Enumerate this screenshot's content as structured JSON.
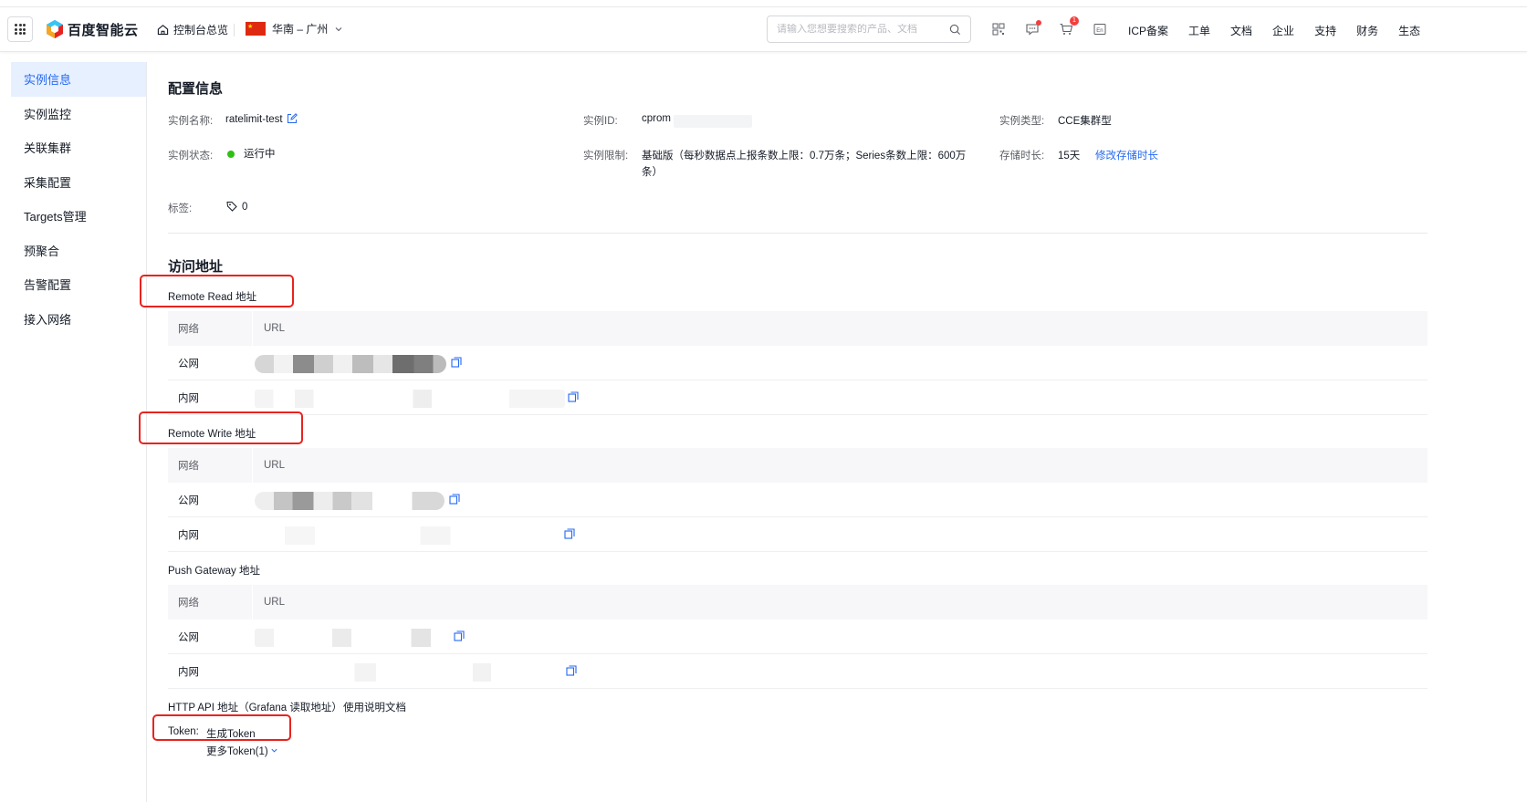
{
  "header": {
    "logo_text": "百度智能云",
    "console_label": "控制台总览",
    "region_label": "华南 – 广州",
    "search_placeholder": "请输入您想要搜索的产品、文档",
    "cart_badge": "1",
    "nav": [
      "ICP备案",
      "工单",
      "文档",
      "企业",
      "支持",
      "财务",
      "生态"
    ],
    "icons": [
      "qrcode-icon",
      "message-icon",
      "cart-icon",
      "language-icon"
    ]
  },
  "sidebar": {
    "items": [
      {
        "label": "实例信息",
        "active": true
      },
      {
        "label": "实例监控",
        "active": false
      },
      {
        "label": "关联集群",
        "active": false
      },
      {
        "label": "采集配置",
        "active": false
      },
      {
        "label": "Targets管理",
        "active": false
      },
      {
        "label": "预聚合",
        "active": false
      },
      {
        "label": "告警配置",
        "active": false
      },
      {
        "label": "接入网络",
        "active": false
      }
    ]
  },
  "config": {
    "title": "配置信息",
    "name_label": "实例名称:",
    "name_value": "ratelimit-test",
    "id_label": "实例ID:",
    "id_value": "cprom",
    "type_label": "实例类型:",
    "type_value": "CCE集群型",
    "status_label": "实例状态:",
    "status_value": "运行中",
    "limit_label": "实例限制:",
    "limit_value_line1": "基础版（每秒数据点上报条数上限：0.7万条；Series条数上限：600万",
    "limit_value_line2": "条）",
    "retention_label": "存储时长:",
    "retention_value": "15天",
    "retention_link": "修改存储时长",
    "tags_label": "标签:",
    "tags_count": "0"
  },
  "access": {
    "title": "访问地址",
    "remote_read_label": "Remote Read 地址",
    "remote_write_label": "Remote Write 地址",
    "push_gateway_label": "Push Gateway 地址",
    "col_network": "网络",
    "col_url": "URL",
    "row_public": "公网",
    "row_private": "内网",
    "http_api_label": "HTTP API 地址（Grafana 读取地址）",
    "http_api_link": "使用说明文档",
    "token_label": "Token:",
    "token_link": "生成Token",
    "more_token": "更多Token(1)"
  },
  "colors": {
    "accent": "#2468f2",
    "status_green": "#30bf13",
    "highlight_red": "#e8231f",
    "sidebar_active_bg": "#e6f0ff"
  }
}
